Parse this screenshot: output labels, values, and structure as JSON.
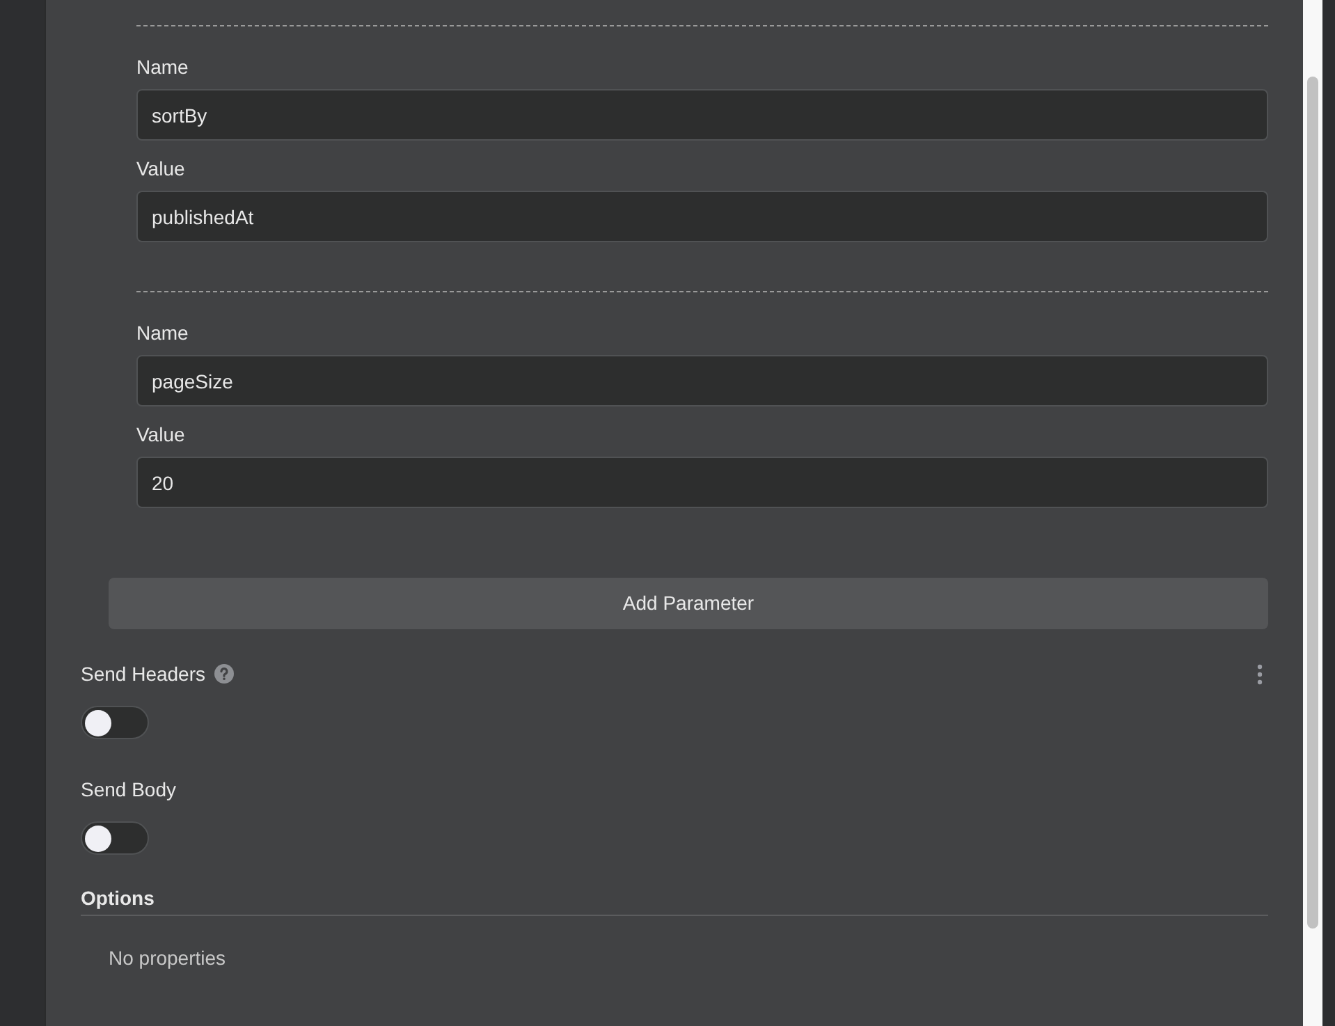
{
  "parameters": [
    {
      "name_label": "Name",
      "name": "sortBy",
      "value_label": "Value",
      "value": "publishedAt"
    },
    {
      "name_label": "Name",
      "name": "pageSize",
      "value_label": "Value",
      "value": "20"
    }
  ],
  "add_button": "Add Parameter",
  "toggles": [
    {
      "label": "Send Headers",
      "on": false,
      "help": true,
      "menu": true
    },
    {
      "label": "Send Body",
      "on": false,
      "help": false,
      "menu": false
    }
  ],
  "options": {
    "title": "Options",
    "empty_text": "No properties"
  }
}
